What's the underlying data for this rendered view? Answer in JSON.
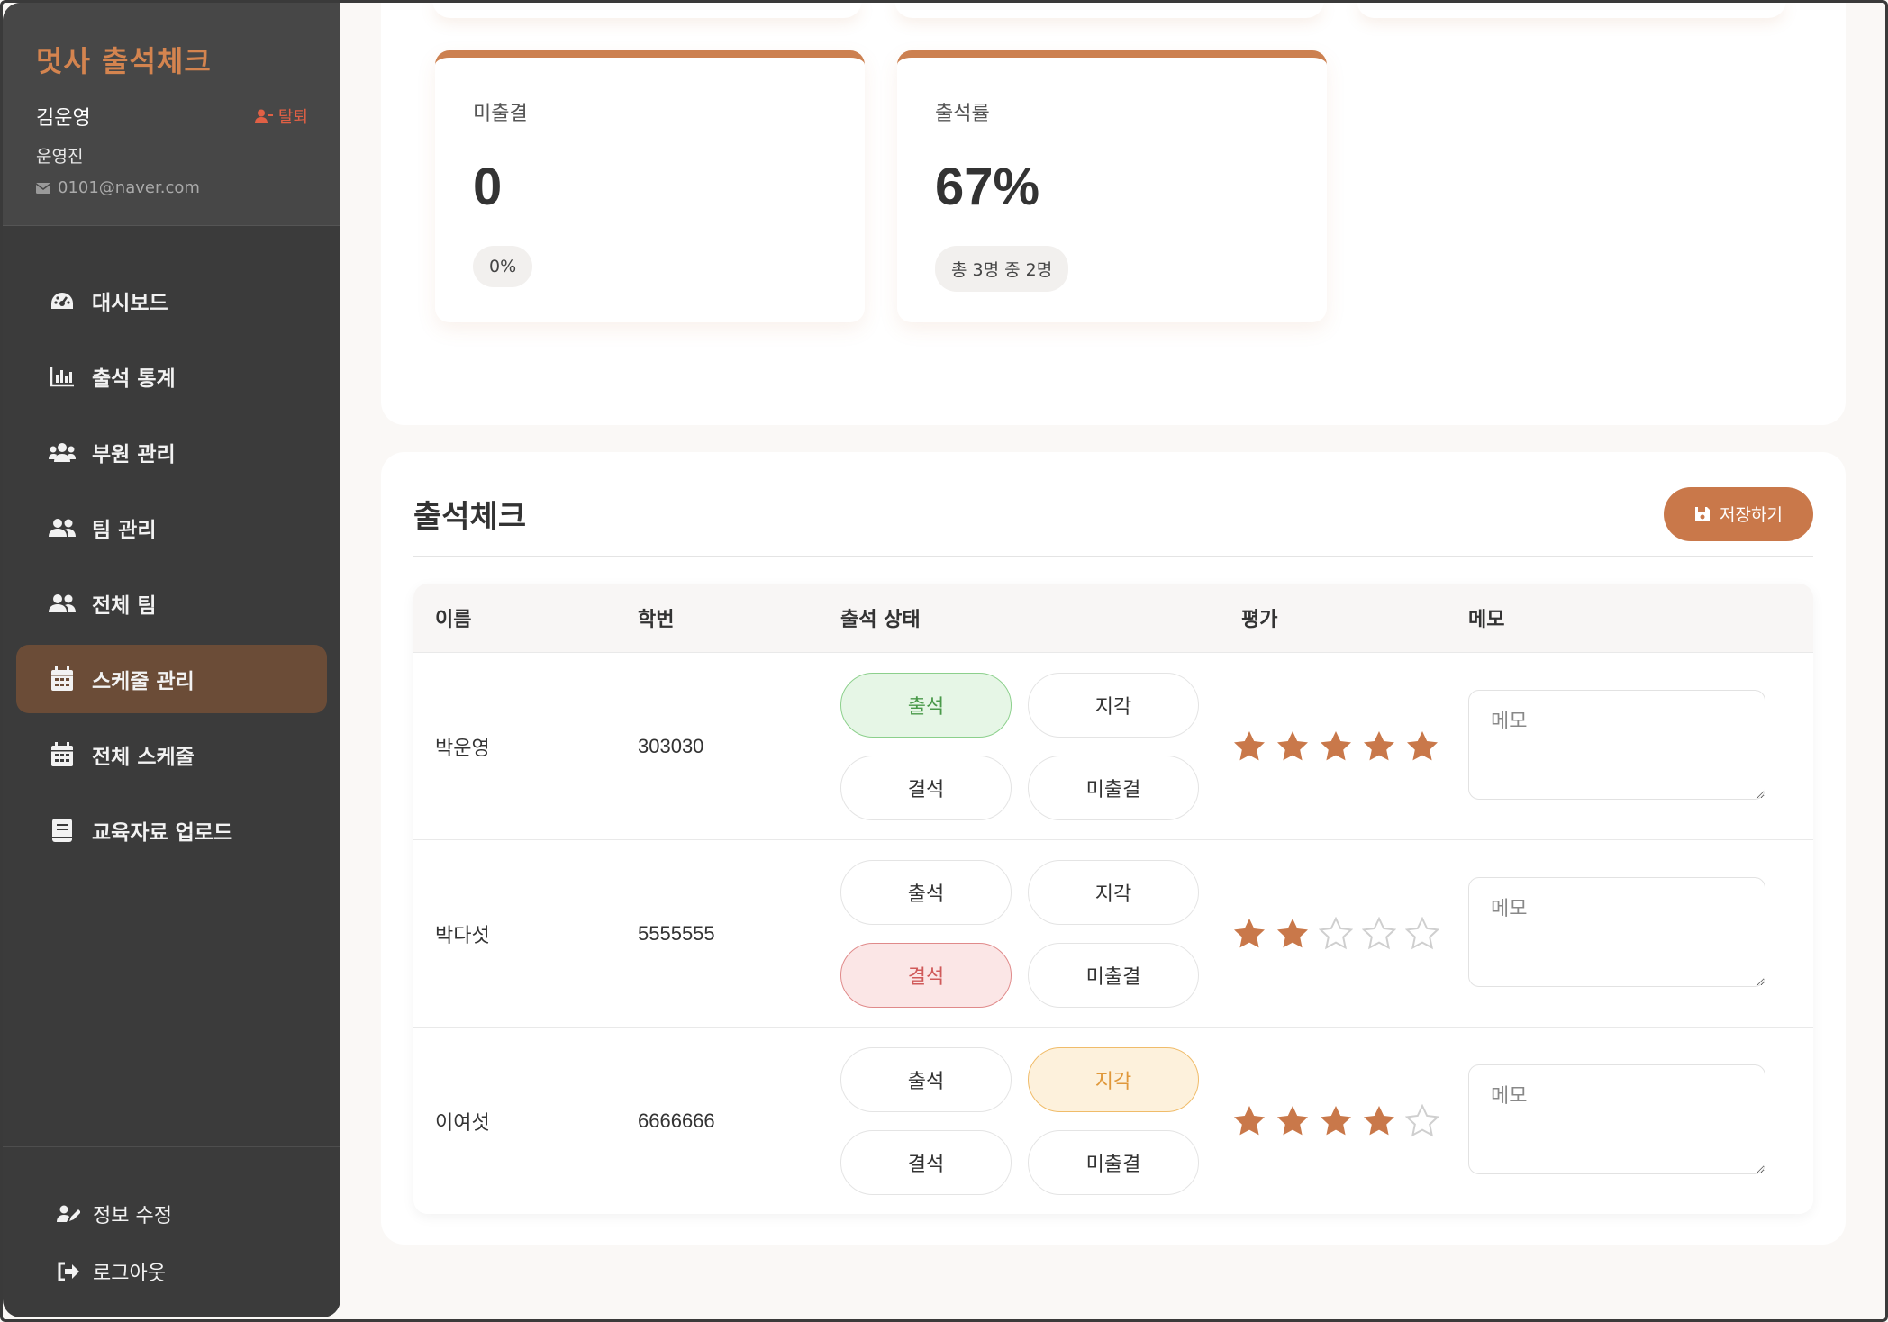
{
  "app": {
    "brand": "멋사 출석체크"
  },
  "user": {
    "name": "김운영",
    "withdraw_label": "탈퇴",
    "role": "운영진",
    "email": "0101@naver.com"
  },
  "nav": [
    {
      "label": "대시보드",
      "icon": "dashboard-icon",
      "active": false
    },
    {
      "label": "출석 통계",
      "icon": "chart-icon",
      "active": false
    },
    {
      "label": "부원 관리",
      "icon": "users-icon",
      "active": false
    },
    {
      "label": "팀 관리",
      "icon": "team-icon",
      "active": false
    },
    {
      "label": "전체 팀",
      "icon": "team-icon",
      "active": false
    },
    {
      "label": "스케줄 관리",
      "icon": "calendar-icon",
      "active": true
    },
    {
      "label": "전체 스케줄",
      "icon": "calendar-icon",
      "active": false
    },
    {
      "label": "교육자료 업로드",
      "icon": "book-icon",
      "active": false
    }
  ],
  "footer": {
    "edit_label": "정보 수정",
    "logout_label": "로그아웃"
  },
  "stats": [
    {
      "label": "미출결",
      "value": "0",
      "pill": "0%"
    },
    {
      "label": "출석률",
      "value": "67%",
      "pill": "총 3명 중 2명"
    }
  ],
  "attendance": {
    "title": "출석체크",
    "save_label": "저장하기",
    "columns": {
      "name": "이름",
      "id": "학번",
      "status": "출석 상태",
      "rating": "평가",
      "memo": "메모"
    },
    "status_labels": {
      "present": "출석",
      "late": "지각",
      "absent": "결석",
      "none": "미출결"
    },
    "memo_placeholder": "메모",
    "rows": [
      {
        "name": "박운영",
        "id": "303030",
        "status": "present",
        "rating": 5
      },
      {
        "name": "박다섯",
        "id": "5555555",
        "status": "absent",
        "rating": 2
      },
      {
        "name": "이여섯",
        "id": "6666666",
        "status": "late",
        "rating": 4
      }
    ],
    "rating_max": 5
  },
  "colors": {
    "accent": "#c9784a",
    "brand": "#d4844f",
    "sidebar_bg": "#3b3b3b",
    "sidebar_active": "#6b4c37",
    "star_filled": "#c9784a",
    "star_empty": "#cfcfcf"
  }
}
